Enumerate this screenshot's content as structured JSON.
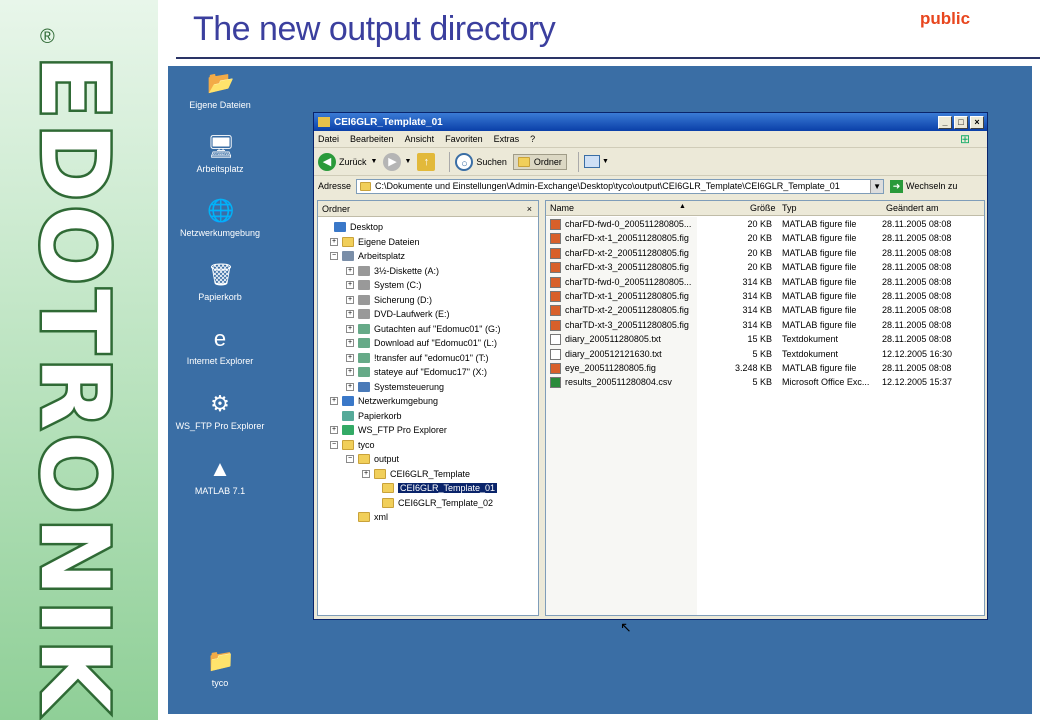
{
  "slide": {
    "title": "The new output directory",
    "tag": "public",
    "brand": "EDOTRONIK",
    "reg": "®"
  },
  "desktop_icons": [
    {
      "label": "Eigene Dateien",
      "icon": "my-documents-icon",
      "glyph": "📂"
    },
    {
      "label": "Arbeitsplatz",
      "icon": "my-computer-icon",
      "glyph": "🖥"
    },
    {
      "label": "Netzwerkumgebung",
      "icon": "network-icon",
      "glyph": "🌐"
    },
    {
      "label": "Papierkorb",
      "icon": "recycle-bin-icon",
      "glyph": "🗑"
    },
    {
      "label": "Internet Explorer",
      "icon": "internet-explorer-icon",
      "glyph": "e"
    },
    {
      "label": "WS_FTP Pro Explorer",
      "icon": "ftp-icon",
      "glyph": "⚙"
    },
    {
      "label": "MATLAB 7.1",
      "icon": "matlab-icon",
      "glyph": "▲"
    },
    {
      "label": "tyco",
      "icon": "folder-icon",
      "glyph": "📁"
    }
  ],
  "window": {
    "title": "CEI6GLR_Template_01",
    "menu": [
      "Datei",
      "Bearbeiten",
      "Ansicht",
      "Favoriten",
      "Extras",
      "?"
    ],
    "toolbar": {
      "back": "Zurück",
      "search": "Suchen",
      "folders": "Ordner"
    },
    "address_label": "Adresse",
    "address": "C:\\Dokumente und Einstellungen\\Admin-Exchange\\Desktop\\tyco\\output\\CEI6GLR_Template\\CEI6GLR_Template_01",
    "go": "Wechseln zu"
  },
  "tree": {
    "header": "Ordner",
    "close": "×",
    "items": [
      {
        "label": "Desktop",
        "pm": ""
      },
      {
        "label": "Eigene Dateien",
        "pm": "+"
      },
      {
        "label": "Arbeitsplatz",
        "pm": "−"
      },
      {
        "label": "3½-Diskette (A:)",
        "pm": "+"
      },
      {
        "label": "System (C:)",
        "pm": "+"
      },
      {
        "label": "Sicherung (D:)",
        "pm": "+"
      },
      {
        "label": "DVD-Laufwerk (E:)",
        "pm": "+"
      },
      {
        "label": "Gutachten auf \"Edomuc01\" (G:)",
        "pm": "+"
      },
      {
        "label": "Download auf \"Edomuc01\" (L:)",
        "pm": "+"
      },
      {
        "label": "!transfer auf \"edomuc01\" (T:)",
        "pm": "+"
      },
      {
        "label": "stateye auf \"Edomuc17\" (X:)",
        "pm": "+"
      },
      {
        "label": "Systemsteuerung",
        "pm": "+"
      },
      {
        "label": "Netzwerkumgebung",
        "pm": "+"
      },
      {
        "label": "Papierkorb",
        "pm": ""
      },
      {
        "label": "WS_FTP Pro Explorer",
        "pm": "+"
      },
      {
        "label": "tyco",
        "pm": "−"
      },
      {
        "label": "output",
        "pm": "−"
      },
      {
        "label": "CEI6GLR_Template",
        "pm": "+"
      },
      {
        "label": "CEI6GLR_Template_01",
        "pm": ""
      },
      {
        "label": "CEI6GLR_Template_02",
        "pm": ""
      },
      {
        "label": "xml",
        "pm": ""
      }
    ]
  },
  "list": {
    "headers": {
      "name": "Name",
      "size": "Größe",
      "type": "Typ",
      "modified": "Geändert am",
      "sort": "▲"
    },
    "files": [
      {
        "name": "charFD-fwd-0_200511280805...",
        "size": "20 KB",
        "type": "MATLAB figure file",
        "modified": "28.11.2005 08:08"
      },
      {
        "name": "charFD-xt-1_200511280805.fig",
        "size": "20 KB",
        "type": "MATLAB figure file",
        "modified": "28.11.2005 08:08"
      },
      {
        "name": "charFD-xt-2_200511280805.fig",
        "size": "20 KB",
        "type": "MATLAB figure file",
        "modified": "28.11.2005 08:08"
      },
      {
        "name": "charFD-xt-3_200511280805.fig",
        "size": "20 KB",
        "type": "MATLAB figure file",
        "modified": "28.11.2005 08:08"
      },
      {
        "name": "charTD-fwd-0_200511280805...",
        "size": "314 KB",
        "type": "MATLAB figure file",
        "modified": "28.11.2005 08:08"
      },
      {
        "name": "charTD-xt-1_200511280805.fig",
        "size": "314 KB",
        "type": "MATLAB figure file",
        "modified": "28.11.2005 08:08"
      },
      {
        "name": "charTD-xt-2_200511280805.fig",
        "size": "314 KB",
        "type": "MATLAB figure file",
        "modified": "28.11.2005 08:08"
      },
      {
        "name": "charTD-xt-3_200511280805.fig",
        "size": "314 KB",
        "type": "MATLAB figure file",
        "modified": "28.11.2005 08:08"
      },
      {
        "name": "diary_200511280805.txt",
        "size": "15 KB",
        "type": "Textdokument",
        "modified": "28.11.2005 08:08"
      },
      {
        "name": "diary_200512121630.txt",
        "size": "5 KB",
        "type": "Textdokument",
        "modified": "12.12.2005 16:30"
      },
      {
        "name": "eye_200511280805.fig",
        "size": "3.248 KB",
        "type": "MATLAB figure file",
        "modified": "28.11.2005 08:08"
      },
      {
        "name": "results_200511280804.csv",
        "size": "5 KB",
        "type": "Microsoft Office Exc...",
        "modified": "12.12.2005 15:37"
      }
    ]
  }
}
